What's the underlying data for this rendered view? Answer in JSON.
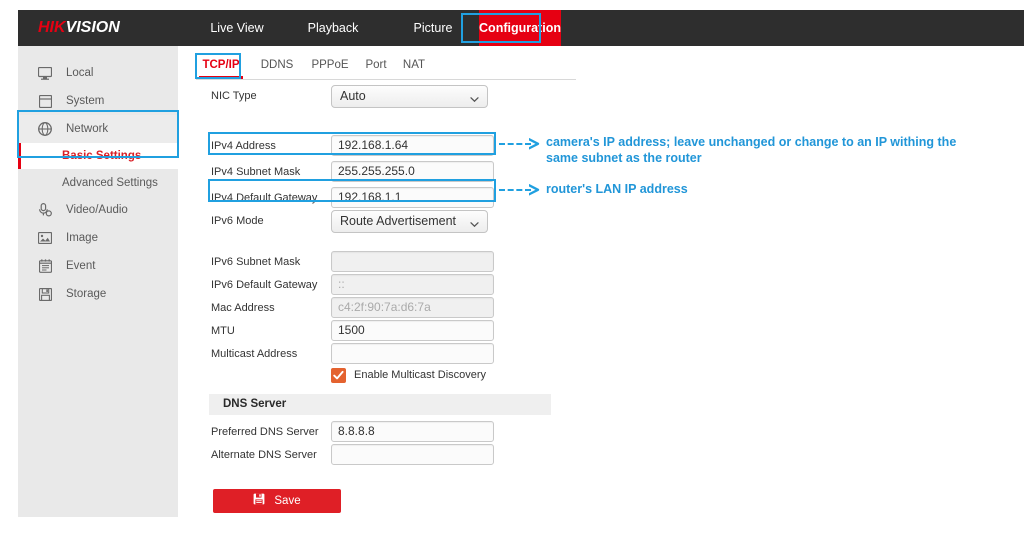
{
  "header": {
    "logo_hik": "HIK",
    "logo_vision": "VISION",
    "tabs": [
      {
        "label": "Live View",
        "name": "tab-live-view"
      },
      {
        "label": "Playback",
        "name": "tab-playback"
      },
      {
        "label": "Picture",
        "name": "tab-picture"
      },
      {
        "label": "Configuration",
        "name": "tab-configuration"
      }
    ],
    "active_tab": "Configuration"
  },
  "sidebar": {
    "items": [
      {
        "label": "Local",
        "icon": "monitor-icon"
      },
      {
        "label": "System",
        "icon": "window-icon"
      },
      {
        "label": "Network",
        "icon": "globe-icon"
      }
    ],
    "subitems": [
      {
        "label": "Basic Settings",
        "active": true
      },
      {
        "label": "Advanced Settings",
        "active": false
      }
    ],
    "items_after": [
      {
        "label": "Video/Audio",
        "icon": "microphone-icon"
      },
      {
        "label": "Image",
        "icon": "picture-icon"
      },
      {
        "label": "Event",
        "icon": "calendar-icon"
      },
      {
        "label": "Storage",
        "icon": "floppy-disk-icon"
      }
    ]
  },
  "content": {
    "tabs": [
      {
        "label": "TCP/IP",
        "active": true
      },
      {
        "label": "DDNS",
        "active": false
      },
      {
        "label": "PPPoE",
        "active": false
      },
      {
        "label": "Port",
        "active": false
      },
      {
        "label": "NAT",
        "active": false
      }
    ],
    "nic_type": {
      "label": "NIC Type",
      "value": "Auto"
    },
    "fields": [
      {
        "label": "IPv4 Address",
        "value": "192.168.1.64",
        "disabled": false
      },
      {
        "label": "IPv4 Subnet Mask",
        "value": "255.255.255.0",
        "disabled": false
      },
      {
        "label": "IPv4 Default Gateway",
        "value": "192.168.1.1",
        "disabled": false
      }
    ],
    "ipv6_mode": {
      "label": "IPv6 Mode",
      "value": "Route Advertisement"
    },
    "fields2": [
      {
        "label": "IPv6 Subnet Mask",
        "value": "",
        "disabled": true
      },
      {
        "label": "IPv6 Default Gateway",
        "value": "::",
        "disabled": true
      },
      {
        "label": "Mac Address",
        "value": "c4:2f:90:7a:d6:7a",
        "disabled": true
      },
      {
        "label": "MTU",
        "value": "1500",
        "disabled": false
      },
      {
        "label": "Multicast Address",
        "value": "",
        "disabled": false
      }
    ],
    "multicast_checkbox": {
      "label": "Enable Multicast Discovery",
      "checked": true
    },
    "dns_group_title": "DNS Server",
    "dns_fields": [
      {
        "label": "Preferred DNS Server",
        "value": "8.8.8.8",
        "disabled": false
      },
      {
        "label": "Alternate DNS Server",
        "value": "",
        "disabled": false
      }
    ],
    "save_button": {
      "label": "Save",
      "icon": "floppy-disk-icon"
    }
  },
  "annotations": {
    "accent_color": "#20a0e0",
    "note_ipv4_address": "camera's IP address; leave unchanged or change to an IP withing the\nsame subnet as the router",
    "note_gateway": "router's LAN IP address"
  }
}
